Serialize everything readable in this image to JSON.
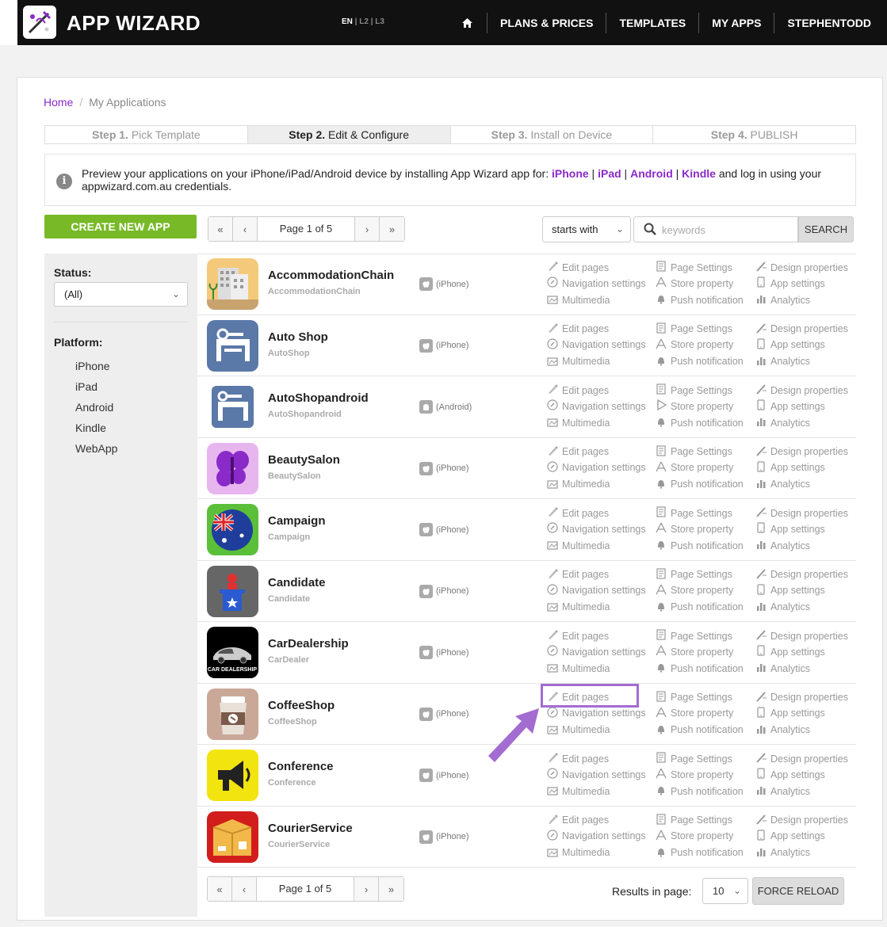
{
  "header": {
    "logo_text": "APP WIZARD",
    "lang_active": "EN",
    "lang_sep1": " | ",
    "lang_l2": "L2",
    "lang_sep2": " | ",
    "lang_l3": "L3",
    "nav": [
      "PLANS & PRICES",
      "TEMPLATES",
      "MY APPS",
      "STEPHENTODD"
    ]
  },
  "breadcrumb": {
    "home": "Home",
    "sep": "/",
    "current": "My Applications"
  },
  "steps": [
    {
      "num": "Step 1.",
      "label": " Pick Template"
    },
    {
      "num": "Step 2.",
      "label": " Edit & Configure"
    },
    {
      "num": "Step 3.",
      "label": " Install on Device"
    },
    {
      "num": "Step 4.",
      "label": " PUBLISH"
    }
  ],
  "info": {
    "text_pre": "Preview your applications on your iPhone/iPad/Android device by installing App Wizard app for: ",
    "links": [
      "iPhone",
      "iPad",
      "Android",
      "Kindle"
    ],
    "sep": " | ",
    "text_post": " and log in using your appwizard.com.au credentials."
  },
  "toolbar": {
    "create_label": "CREATE NEW APP",
    "page_label": "Page 1 of 5",
    "filter_value": "starts with",
    "search_placeholder": "keywords",
    "search_label": "SEARCH"
  },
  "sidebar": {
    "status_label": "Status:",
    "status_value": "(All)",
    "platform_label": "Platform:",
    "platforms": [
      "iPhone",
      "iPad",
      "Android",
      "Kindle",
      "WebApp"
    ]
  },
  "actions": {
    "edit_pages": "Edit pages",
    "page_settings": "Page Settings",
    "design_properties": "Design properties",
    "navigation_settings": "Navigation settings",
    "store_property": "Store property",
    "app_settings": "App settings",
    "multimedia": "Multimedia",
    "push_notification": "Push notification",
    "analytics": "Analytics"
  },
  "apps": [
    {
      "name": "AccommodationChain",
      "sub": "AccommodationChain",
      "platform": "(iPhone)"
    },
    {
      "name": "Auto Shop",
      "sub": "AutoShop",
      "platform": "(iPhone)"
    },
    {
      "name": "AutoShopandroid",
      "sub": "AutoShopandroid",
      "platform": "(Android)"
    },
    {
      "name": "BeautySalon",
      "sub": "BeautySalon",
      "platform": "(iPhone)"
    },
    {
      "name": "Campaign",
      "sub": "Campaign",
      "platform": "(iPhone)"
    },
    {
      "name": "Candidate",
      "sub": "Candidate",
      "platform": "(iPhone)"
    },
    {
      "name": "CarDealership",
      "sub": "CarDealer",
      "platform": "(iPhone)",
      "icon_text": "CAR DEALERSHIP"
    },
    {
      "name": "CoffeeShop",
      "sub": "CoffeeShop",
      "platform": "(iPhone)"
    },
    {
      "name": "Conference",
      "sub": "Conference",
      "platform": "(iPhone)"
    },
    {
      "name": "CourierService",
      "sub": "CourierService",
      "platform": "(iPhone)"
    }
  ],
  "footer": {
    "page_label": "Page 1 of 5",
    "results_label": "Results in page:",
    "results_value": "10",
    "reload_label": "FORCE RELOAD"
  },
  "colors": {
    "accent": "#8a2ac9",
    "create": "#78b928",
    "highlight": "#a36cd0"
  }
}
